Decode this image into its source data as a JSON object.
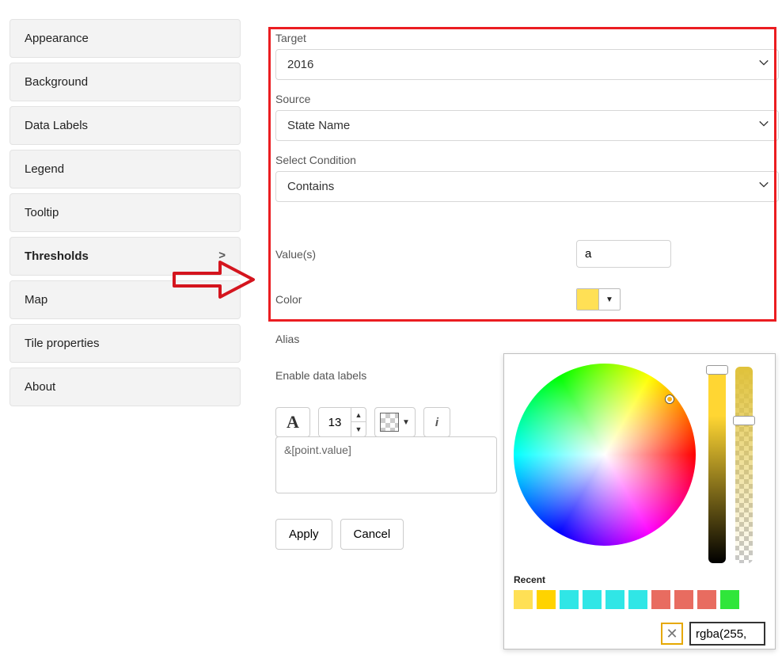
{
  "sidebar": {
    "items": [
      {
        "key": "appearance",
        "label": "Appearance"
      },
      {
        "key": "background",
        "label": "Background"
      },
      {
        "key": "datalabels",
        "label": "Data Labels"
      },
      {
        "key": "legend",
        "label": "Legend"
      },
      {
        "key": "tooltip",
        "label": "Tooltip"
      },
      {
        "key": "thresholds",
        "label": "Thresholds",
        "chevron": ">",
        "active": true
      },
      {
        "key": "map",
        "label": "Map"
      },
      {
        "key": "tileprops",
        "label": "Tile properties"
      },
      {
        "key": "about",
        "label": "About"
      }
    ]
  },
  "form": {
    "target": {
      "label": "Target",
      "value": "2016"
    },
    "source": {
      "label": "Source",
      "value": "State Name"
    },
    "condition": {
      "label": "Select Condition",
      "value": "Contains"
    },
    "values": {
      "label": "Value(s)",
      "value": "a"
    },
    "color": {
      "label": "Color",
      "swatch": "#ffe055"
    },
    "alias": {
      "label": "Alias"
    },
    "enable_labels": {
      "label": "Enable data labels"
    }
  },
  "toolbar": {
    "font_button": "A",
    "fontsize": "13",
    "info": "i"
  },
  "template": {
    "value": "&[point.value]"
  },
  "buttons": {
    "apply": "Apply",
    "cancel": "Cancel"
  },
  "color_picker": {
    "recent_label": "Recent",
    "recent": [
      "#ffe055",
      "#ffd300",
      "#30e6e6",
      "#30e6e6",
      "#30e6e6",
      "#30e6e6",
      "#e86c60",
      "#e86c60",
      "#e86c60",
      "#30e63a"
    ],
    "close": "✕",
    "value": "rgba(255,"
  }
}
